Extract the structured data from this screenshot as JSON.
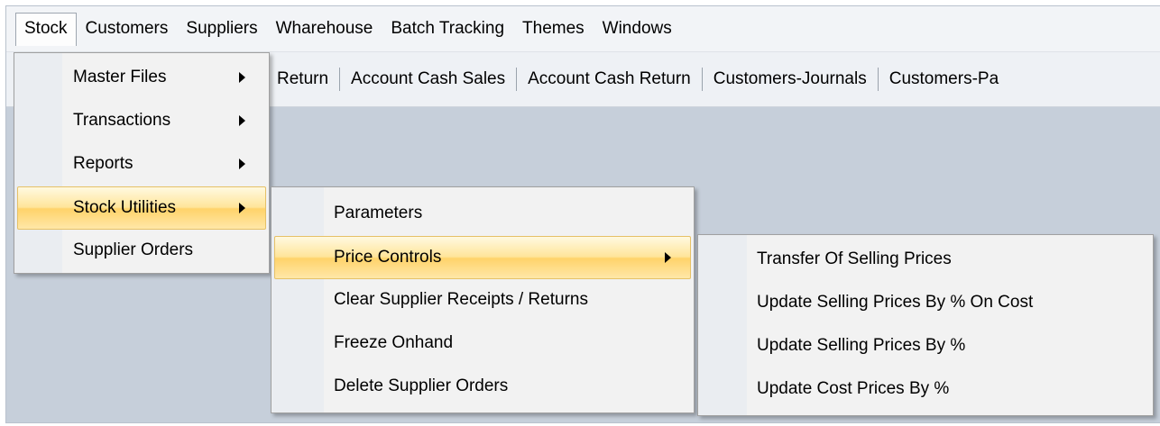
{
  "menubar": {
    "items": [
      "Stock",
      "Customers",
      "Suppliers",
      "Wharehouse",
      "Batch Tracking",
      "Themes",
      "Windows"
    ]
  },
  "toolbar": {
    "items": [
      "Return",
      "Account Cash Sales",
      "Account Cash Return",
      "Customers-Journals",
      "Customers-Pa"
    ]
  },
  "stock_menu": {
    "items": [
      {
        "label": "Master Files",
        "has_submenu": true
      },
      {
        "label": "Transactions",
        "has_submenu": true
      },
      {
        "label": "Reports",
        "has_submenu": true
      },
      {
        "label": "Stock Utilities",
        "has_submenu": true,
        "highlighted": true
      },
      {
        "label": "Supplier Orders",
        "has_submenu": false
      }
    ]
  },
  "stock_utilities_menu": {
    "items": [
      {
        "label": "Parameters",
        "has_submenu": false
      },
      {
        "label": "Price Controls",
        "has_submenu": true,
        "highlighted": true
      },
      {
        "label": "Clear Supplier Receipts / Returns",
        "has_submenu": false
      },
      {
        "label": "Freeze Onhand",
        "has_submenu": false
      },
      {
        "label": "Delete Supplier Orders",
        "has_submenu": false
      }
    ]
  },
  "price_controls_menu": {
    "items": [
      {
        "label": "Transfer Of Selling Prices"
      },
      {
        "label": "Update Selling Prices By % On Cost"
      },
      {
        "label": "Update Selling Prices By %"
      },
      {
        "label": "Update Cost Prices By %"
      }
    ]
  },
  "colors": {
    "workspace": "#c6cfda",
    "menubar": "#f2f4f7",
    "menu_bg": "#f2f2f2",
    "highlight": "#ffd36a"
  }
}
